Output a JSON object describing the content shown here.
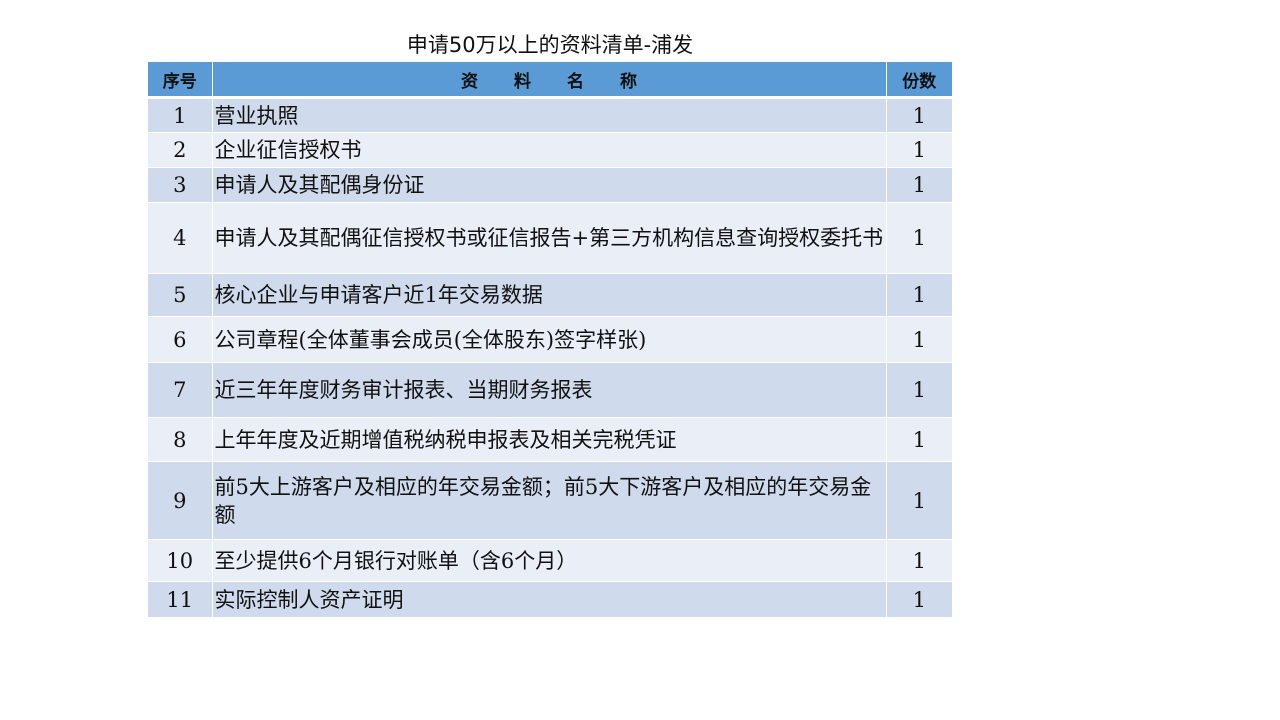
{
  "title": "申请50万以上的资料清单-浦发",
  "table": {
    "headers": {
      "no": "序号",
      "name": "资料名称",
      "copies": "份数"
    },
    "rows": [
      {
        "no": "1",
        "name": "营业执照",
        "copies": "1"
      },
      {
        "no": "2",
        "name": "企业征信授权书",
        "copies": "1"
      },
      {
        "no": "3",
        "name": "申请人及其配偶身份证",
        "copies": "1"
      },
      {
        "no": "4",
        "name": "申请人及其配偶征信授权书或征信报告+第三方机构信息查询授权委托书",
        "copies": "1"
      },
      {
        "no": "5",
        "name": "核心企业与申请客户近1年交易数据",
        "copies": "1"
      },
      {
        "no": "6",
        "name": "公司章程(全体董事会成员(全体股东)签字样张)",
        "copies": "1"
      },
      {
        "no": "7",
        "name": "近三年年度财务审计报表、当期财务报表",
        "copies": "1"
      },
      {
        "no": "8",
        "name": "上年年度及近期增值税纳税申报表及相关完税凭证",
        "copies": "1"
      },
      {
        "no": "9",
        "name": "前5大上游客户及相应的年交易金额；前5大下游客户及相应的年交易金额",
        "copies": "1"
      },
      {
        "no": "10",
        "name": "至少提供6个月银行对账单（含6个月）",
        "copies": "1"
      },
      {
        "no": "11",
        "name": "实际控制人资产证明",
        "copies": "1"
      }
    ]
  }
}
